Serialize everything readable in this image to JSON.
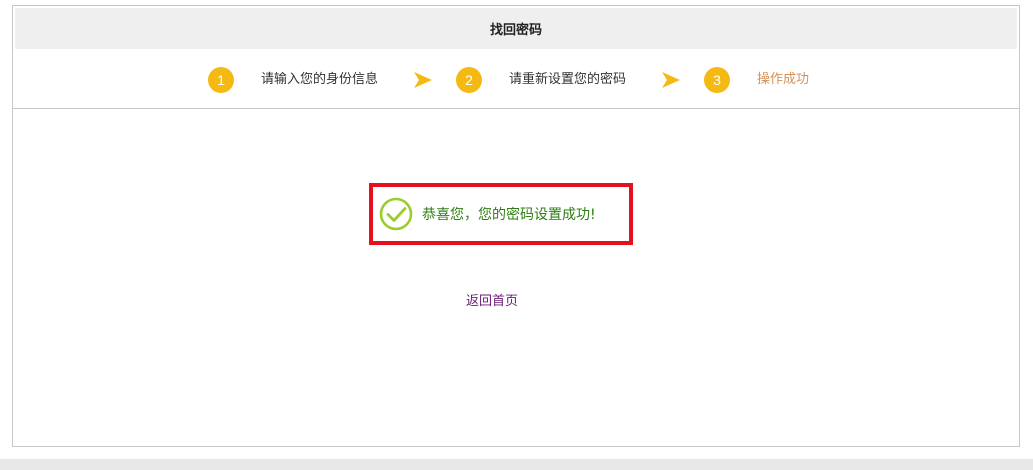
{
  "header": {
    "title": "找回密码"
  },
  "steps": [
    {
      "number": "1",
      "label": "请输入您的身份信息"
    },
    {
      "number": "2",
      "label": "请重新设置您的密码"
    },
    {
      "number": "3",
      "label": "操作成功"
    }
  ],
  "result": {
    "message": "恭喜您，您的密码设置成功!",
    "icon": "check-circle-icon"
  },
  "links": {
    "home": "返回首页"
  },
  "colors": {
    "step_circle": "#f5b913",
    "active_step": "#d4915a",
    "success_text": "#2e7d12",
    "highlight_border": "#e5101d",
    "check_icon": "#9ccc2f",
    "link": "#6a1b73"
  }
}
